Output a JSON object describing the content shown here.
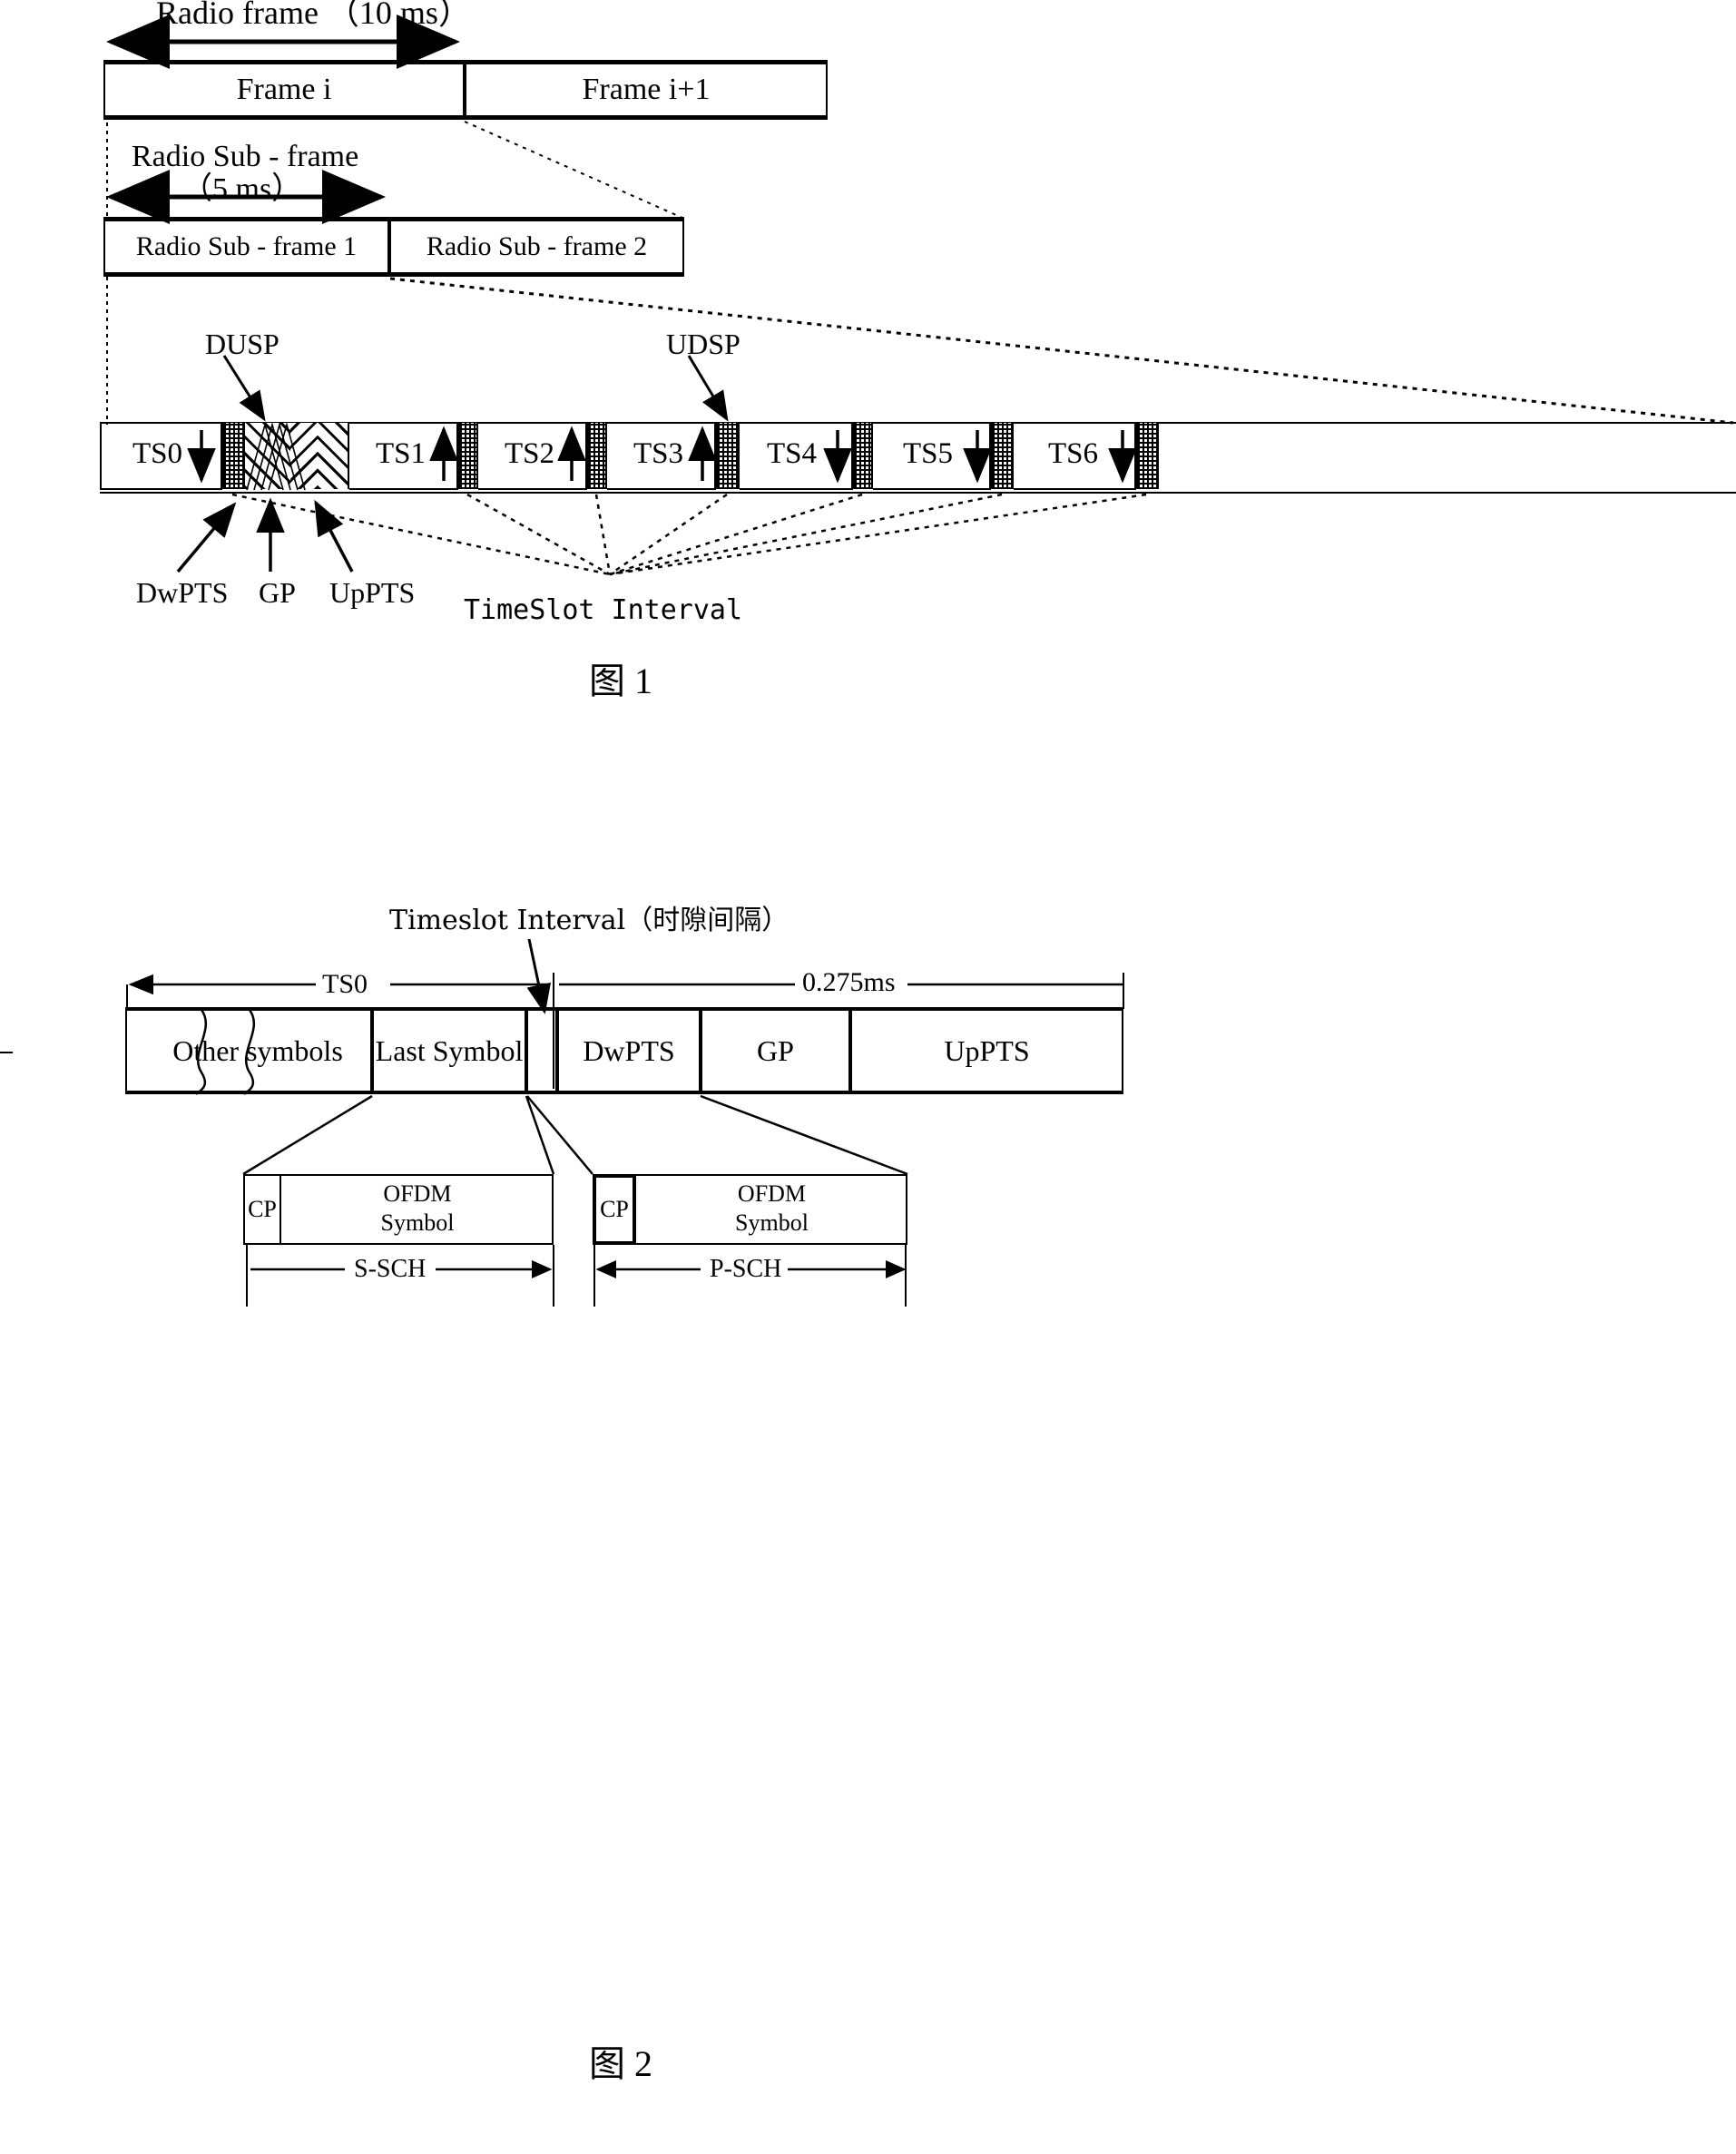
{
  "figure1": {
    "caption": "图 1",
    "radio_frame_label": "Radio frame （10 ms）",
    "radio_subframe_label_line1": "Radio  Sub - frame",
    "radio_subframe_label_line2": "（5 ms）",
    "frames": [
      {
        "label": "Frame  i"
      },
      {
        "label": "Frame  i+1"
      }
    ],
    "subframes": [
      {
        "label": "Radio  Sub - frame 1"
      },
      {
        "label": "Radio  Sub - frame  2"
      }
    ],
    "annotations": {
      "dusp": "DUSP",
      "udsp": "UDSP",
      "dwpts": "DwPTS",
      "gp": "GP",
      "uppts": "UpPTS",
      "timeslot_interval": "TimeSlot Interval"
    },
    "timeslots": [
      {
        "label": "TS0",
        "direction": "down"
      },
      {
        "label": "TS1",
        "direction": "up"
      },
      {
        "label": "TS2",
        "direction": "up"
      },
      {
        "label": "TS3",
        "direction": "up"
      },
      {
        "label": "TS4",
        "direction": "down"
      },
      {
        "label": "TS5",
        "direction": "down"
      },
      {
        "label": "TS6",
        "direction": "down"
      }
    ],
    "special_slots": [
      {
        "label": "DwPTS",
        "pattern": "forward-hatch"
      },
      {
        "label": "GP",
        "pattern": "mixed-hatch"
      },
      {
        "label": "UpPTS",
        "pattern": "back-hatch"
      }
    ]
  },
  "figure2": {
    "caption": "图 2",
    "title_annotation": "Timeslot Interval（时隙间隔）",
    "measure_left": "TS0",
    "measure_right": "0.275ms",
    "blocks": [
      {
        "label": "Other symbols"
      },
      {
        "label": "Last Symbol"
      },
      {
        "label": ""
      },
      {
        "label": "DwPTS"
      },
      {
        "label": "GP"
      },
      {
        "label": "UpPTS"
      }
    ],
    "detail_left": {
      "cp": "CP",
      "symbol_line1": "OFDM",
      "symbol_line2": "Symbol",
      "channel": "S-SCH"
    },
    "detail_right": {
      "cp": "CP",
      "symbol_line1": "OFDM",
      "symbol_line2": "Symbol",
      "channel": "P-SCH"
    }
  }
}
